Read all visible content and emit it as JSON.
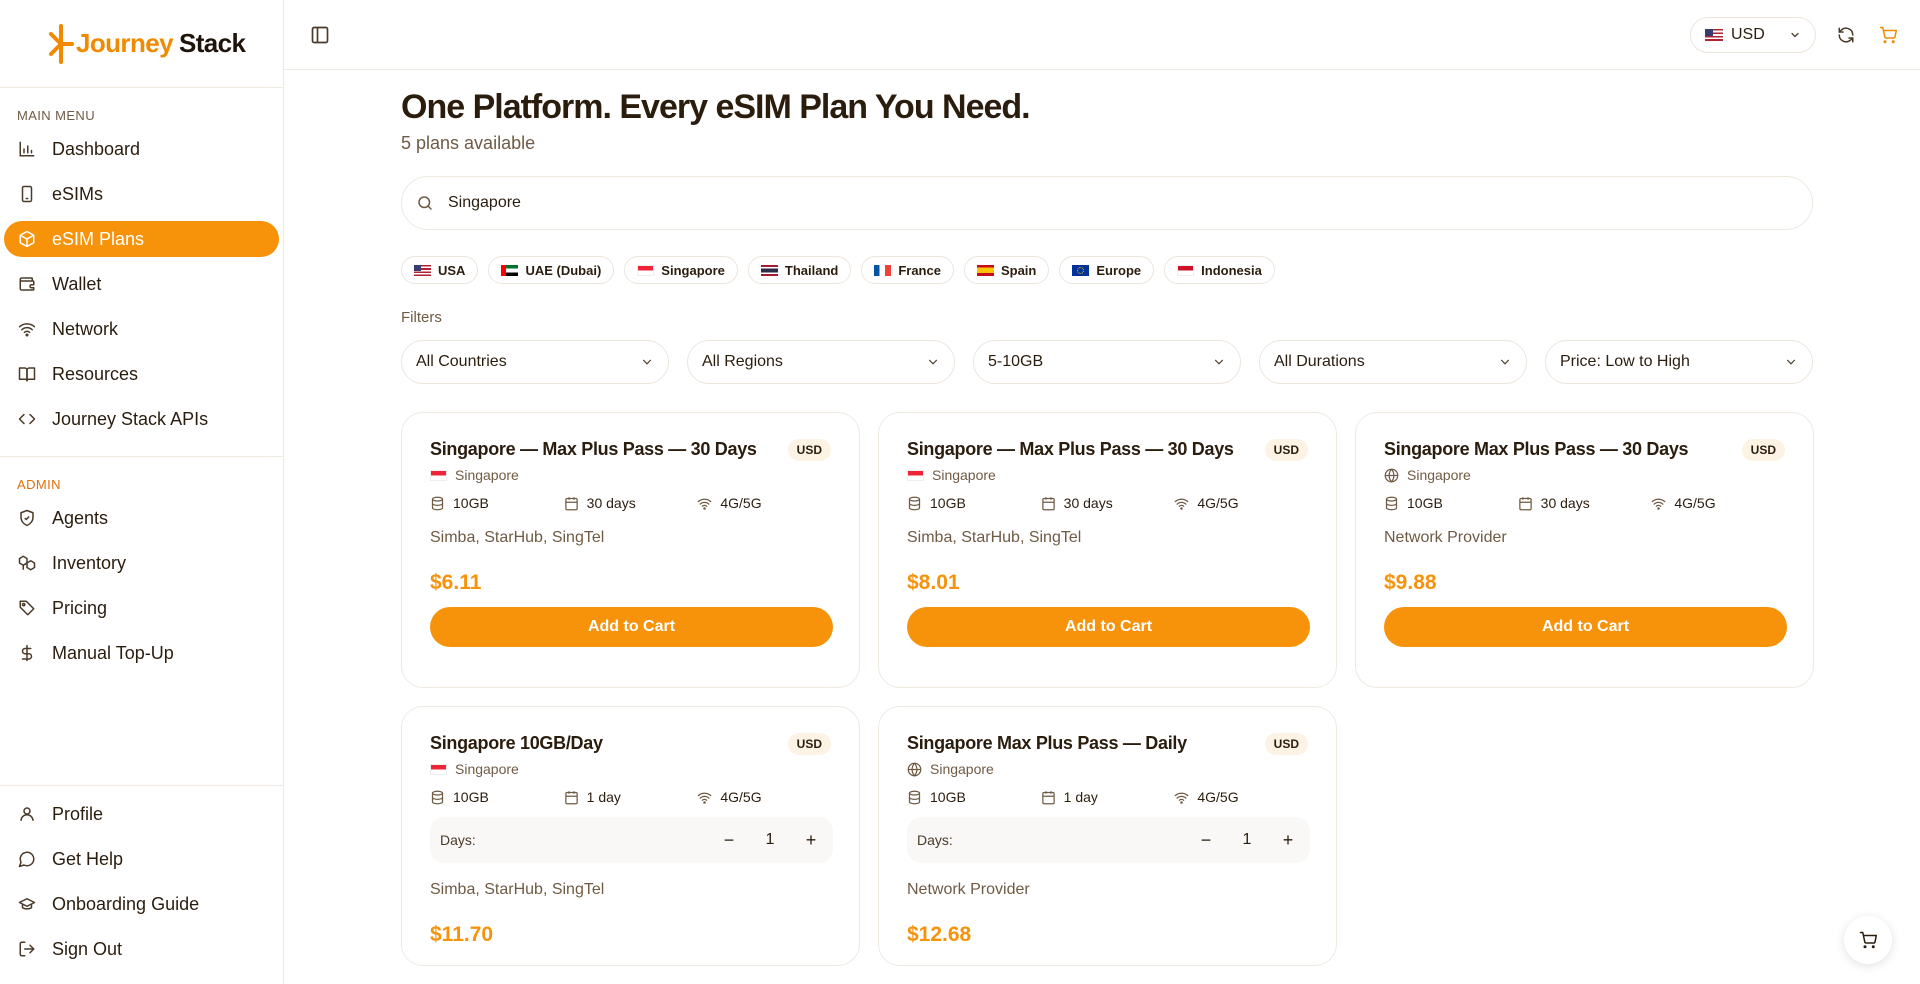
{
  "brand": {
    "part1": "Journey",
    "part2": "Stack",
    "accent": "#f7920b"
  },
  "sidebar": {
    "main_menu_label": "MAIN MENU",
    "main_items": [
      {
        "label": "Dashboard",
        "icon": "bar-chart-icon"
      },
      {
        "label": "eSIMs",
        "icon": "phone-icon"
      },
      {
        "label": "eSIM Plans",
        "icon": "package-icon",
        "active": true
      },
      {
        "label": "Wallet",
        "icon": "wallet-icon"
      },
      {
        "label": "Network",
        "icon": "wifi-icon"
      },
      {
        "label": "Resources",
        "icon": "book-icon"
      },
      {
        "label": "Journey Stack APIs",
        "icon": "code-icon"
      }
    ],
    "admin_label": "ADMIN",
    "admin_items": [
      {
        "label": "Agents",
        "icon": "shield-check-icon"
      },
      {
        "label": "Inventory",
        "icon": "boxes-icon"
      },
      {
        "label": "Pricing",
        "icon": "tags-icon"
      },
      {
        "label": "Manual Top-Up",
        "icon": "dollar-icon"
      }
    ],
    "bottom_items": [
      {
        "label": "Profile",
        "icon": "user-icon"
      },
      {
        "label": "Get Help",
        "icon": "chat-icon"
      },
      {
        "label": "Onboarding Guide",
        "icon": "graduation-cap-icon"
      },
      {
        "label": "Sign Out",
        "icon": "logout-icon"
      }
    ]
  },
  "topbar": {
    "currency": "USD"
  },
  "page": {
    "title": "One Platform. Every eSIM Plan You Need.",
    "subtitle": "5 plans available",
    "search_value": "Singapore",
    "chips": [
      "USA",
      "UAE (Dubai)",
      "Singapore",
      "Thailand",
      "France",
      "Spain",
      "Europe",
      "Indonesia"
    ],
    "filters_label": "Filters",
    "filters": [
      "All Countries",
      "All Regions",
      "5-10GB",
      "All Durations",
      "Price: Low to High"
    ]
  },
  "plans": [
    {
      "title": "Singapore — Max Plus Pass — 30 Days",
      "badge": "USD",
      "country": "Singapore",
      "country_icon": "flag",
      "data": "10GB",
      "duration": "30 days",
      "network_type": "4G/5G",
      "networks": "Simba, StarHub, SingTel",
      "price": "$6.11",
      "cta": "Add to Cart"
    },
    {
      "title": "Singapore — Max Plus Pass — 30 Days",
      "badge": "USD",
      "country": "Singapore",
      "country_icon": "flag",
      "data": "10GB",
      "duration": "30 days",
      "network_type": "4G/5G",
      "networks": "Simba, StarHub, SingTel",
      "price": "$8.01",
      "cta": "Add to Cart"
    },
    {
      "title": "Singapore Max Plus Pass — 30 Days",
      "badge": "USD",
      "country": "Singapore",
      "country_icon": "globe",
      "data": "10GB",
      "duration": "30 days",
      "network_type": "4G/5G",
      "networks": "Network Provider",
      "price": "$9.88",
      "cta": "Add to Cart"
    },
    {
      "title": "Singapore 10GB/Day",
      "badge": "USD",
      "country": "Singapore",
      "country_icon": "flag",
      "data": "10GB",
      "duration": "1 day",
      "network_type": "4G/5G",
      "days_label": "Days:",
      "days_value": "1",
      "networks": "Simba, StarHub, SingTel",
      "price": "$11.70"
    },
    {
      "title": "Singapore Max Plus Pass — Daily",
      "badge": "USD",
      "country": "Singapore",
      "country_icon": "globe",
      "data": "10GB",
      "duration": "1 day",
      "network_type": "4G/5G",
      "days_label": "Days:",
      "days_value": "1",
      "networks": "Network Provider",
      "price": "$12.68"
    }
  ]
}
